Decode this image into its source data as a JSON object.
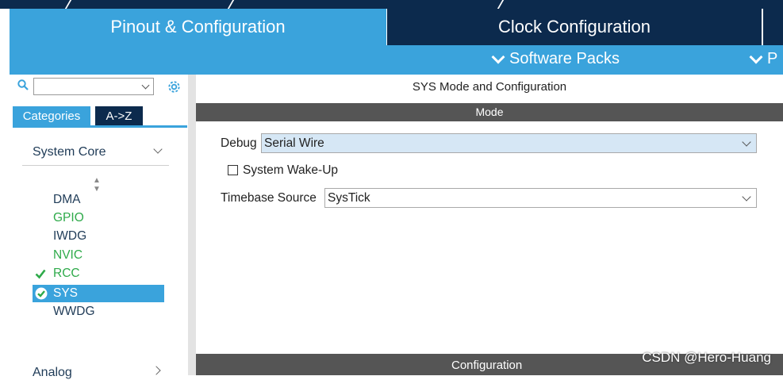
{
  "tabs": {
    "pinout": "Pinout & Configuration",
    "clock": "Clock Configuration"
  },
  "subbar": {
    "software_packs": "Software Packs",
    "partial": "P"
  },
  "left": {
    "search_placeholder": "",
    "category_tabs": [
      "Categories",
      "A->Z"
    ],
    "group": "System Core",
    "items": [
      {
        "label": "DMA",
        "state": "normal"
      },
      {
        "label": "GPIO",
        "state": "green"
      },
      {
        "label": "IWDG",
        "state": "normal"
      },
      {
        "label": "NVIC",
        "state": "green"
      },
      {
        "label": "RCC",
        "state": "configured"
      },
      {
        "label": "SYS",
        "state": "selected"
      },
      {
        "label": "WWDG",
        "state": "normal"
      }
    ],
    "next_group": "Analog"
  },
  "right": {
    "title": "SYS Mode and Configuration",
    "mode_header": "Mode",
    "debug_label": "Debug",
    "debug_value": "Serial Wire",
    "wakeup_label": "System Wake-Up",
    "timebase_label": "Timebase Source",
    "timebase_value": "SysTick",
    "config_header": "Configuration"
  },
  "watermark": "CSDN @Hero-Huang",
  "colors": {
    "accent_blue": "#3aa3dc",
    "navy": "#0c2a4d",
    "green_text": "#2eaa4a",
    "header_gray": "#555555"
  }
}
